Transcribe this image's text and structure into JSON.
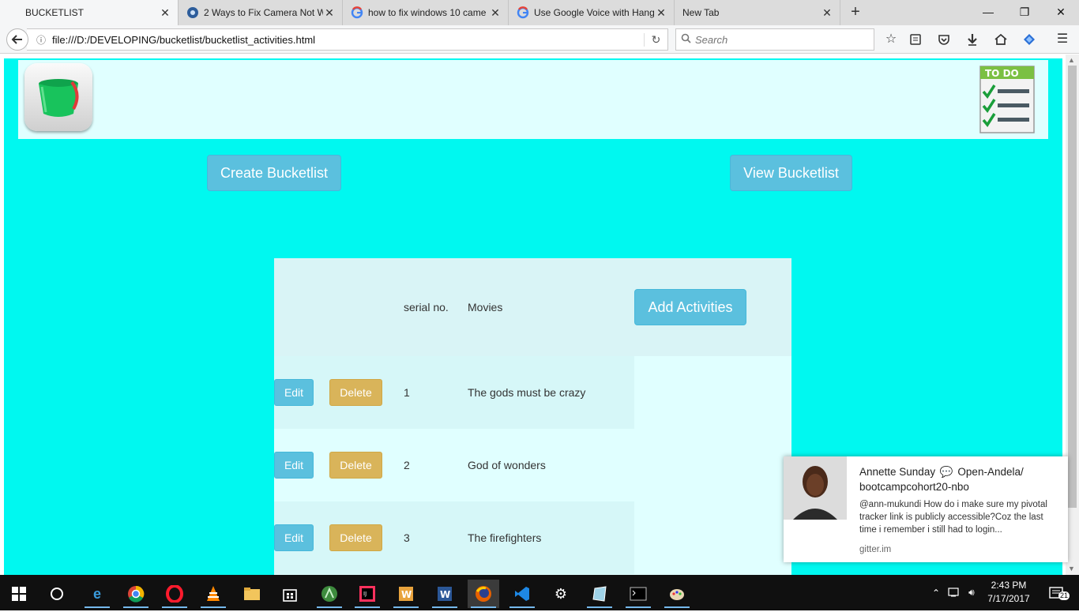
{
  "browser": {
    "tabs": [
      {
        "title": "BUCKETLIST",
        "active": true,
        "icon": "page-icon"
      },
      {
        "title": "2 Ways to Fix Camera Not W",
        "active": false,
        "icon": "site-icon"
      },
      {
        "title": "how to fix windows 10 came",
        "active": false,
        "icon": "google-icon"
      },
      {
        "title": "Use Google Voice with Hang",
        "active": false,
        "icon": "google-icon"
      },
      {
        "title": "New Tab",
        "active": false,
        "icon": "blank"
      }
    ],
    "new_tab_symbol": "+",
    "url": "file:///D:/DEVELOPING/bucketlist/bucketlist_activities.html",
    "search_placeholder": "Search",
    "window_controls": {
      "minimize": "—",
      "restore": "❐",
      "close": "✕"
    }
  },
  "page": {
    "buttons": {
      "create": "Create Bucketlist",
      "view": "View Bucketlist",
      "add": "Add Activities"
    },
    "table": {
      "headers": {
        "serial": "serial no.",
        "category": "Movies"
      },
      "rows": [
        {
          "serial": "1",
          "name": "The gods must be crazy"
        },
        {
          "serial": "2",
          "name": "God of wonders"
        },
        {
          "serial": "3",
          "name": "The firefighters"
        }
      ],
      "edit_label": "Edit",
      "delete_label": "Delete"
    },
    "todo_logo_text": "TO DO"
  },
  "notification": {
    "sender": "Annette Sunday",
    "room": "Open-Andela/ bootcampcohort20-nbo",
    "message": "@ann-mukundi How do i make sure my pivotal tracker  link is publicly accessible?Coz the last time i remember i still had to login...",
    "source": "gitter.im"
  },
  "taskbar": {
    "time": "2:43 PM",
    "date": "7/17/2017",
    "notification_count": "21"
  },
  "colors": {
    "page_bg": "#00f8f0",
    "header_bg": "#e0ffff",
    "primary_button": "#5bc0de",
    "warning_button": "#d9b45a"
  }
}
